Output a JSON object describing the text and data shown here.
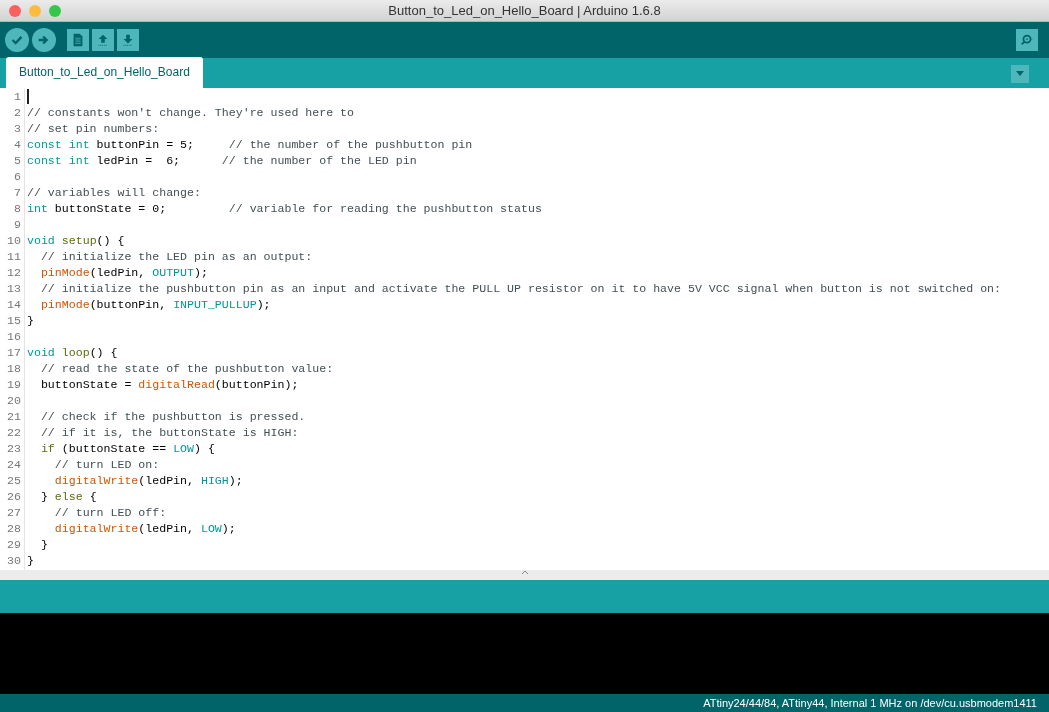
{
  "window": {
    "title": "Button_to_Led_on_Hello_Board | Arduino 1.6.8"
  },
  "toolbar": {
    "buttons": [
      {
        "kind": "verify"
      },
      {
        "kind": "upload"
      },
      {
        "kind": "new"
      },
      {
        "kind": "open"
      },
      {
        "kind": "save"
      }
    ],
    "right_button": {
      "kind": "serial"
    }
  },
  "tabs": [
    {
      "label": "Button_to_Led_on_Hello_Board",
      "selected": true
    }
  ],
  "editor": {
    "lines": [
      {
        "number": "1",
        "cursor": true
      },
      {
        "number": "2",
        "tokens": [
          {
            "kind": "comment",
            "text": "// constants won't change. They're used here to"
          }
        ]
      },
      {
        "number": "3",
        "tokens": [
          {
            "kind": "comment",
            "text": "// set pin numbers:"
          }
        ]
      },
      {
        "number": "4",
        "tokens": [
          {
            "kind": "keyword",
            "text": "const int"
          },
          {
            "kind": "plain",
            "text": " buttonPin = 5;     "
          },
          {
            "kind": "comment",
            "text": "// the number of the pushbutton pin"
          }
        ]
      },
      {
        "number": "5",
        "tokens": [
          {
            "kind": "keyword",
            "text": "const int"
          },
          {
            "kind": "plain",
            "text": " ledPin =  6;      "
          },
          {
            "kind": "comment",
            "text": "// the number of the LED pin"
          }
        ]
      },
      {
        "number": "6"
      },
      {
        "number": "7",
        "tokens": [
          {
            "kind": "comment",
            "text": "// variables will change:"
          }
        ]
      },
      {
        "number": "8",
        "tokens": [
          {
            "kind": "keyword",
            "text": "int"
          },
          {
            "kind": "plain",
            "text": " buttonState = 0;         "
          },
          {
            "kind": "comment",
            "text": "// variable for reading the pushbutton status"
          }
        ]
      },
      {
        "number": "9"
      },
      {
        "number": "10",
        "tokens": [
          {
            "kind": "keyword",
            "text": "void "
          },
          {
            "kind": "structure",
            "text": "setup"
          },
          {
            "kind": "plain",
            "text": "() {"
          }
        ]
      },
      {
        "number": "11",
        "tokens": [
          {
            "kind": "comment",
            "text": "  // initialize the LED pin as an output:"
          }
        ]
      },
      {
        "number": "12",
        "tokens": [
          {
            "kind": "function",
            "text": "  pinMode"
          },
          {
            "kind": "plain",
            "text": "(ledPin, "
          },
          {
            "kind": "constant",
            "text": "OUTPUT"
          },
          {
            "kind": "plain",
            "text": ");"
          }
        ]
      },
      {
        "number": "13",
        "tokens": [
          {
            "kind": "comment",
            "text": "  // initialize the pushbutton pin as an input and activate the PULL UP resistor on it to have 5V VCC signal when button is not switched on:"
          }
        ]
      },
      {
        "number": "14",
        "tokens": [
          {
            "kind": "function",
            "text": "  pinMode"
          },
          {
            "kind": "plain",
            "text": "(buttonPin, "
          },
          {
            "kind": "constant",
            "text": "INPUT_PULLUP"
          },
          {
            "kind": "plain",
            "text": ");"
          }
        ]
      },
      {
        "number": "15",
        "tokens": [
          {
            "kind": "plain",
            "text": "}"
          }
        ]
      },
      {
        "number": "16"
      },
      {
        "number": "17",
        "tokens": [
          {
            "kind": "keyword",
            "text": "void "
          },
          {
            "kind": "structure",
            "text": "loop"
          },
          {
            "kind": "plain",
            "text": "() {"
          }
        ]
      },
      {
        "number": "18",
        "tokens": [
          {
            "kind": "comment",
            "text": "  // read the state of the pushbutton value:"
          }
        ]
      },
      {
        "number": "19",
        "tokens": [
          {
            "kind": "plain",
            "text": "  buttonState = "
          },
          {
            "kind": "function",
            "text": "digitalRead"
          },
          {
            "kind": "plain",
            "text": "(buttonPin);"
          }
        ]
      },
      {
        "number": "20"
      },
      {
        "number": "21",
        "tokens": [
          {
            "kind": "comment",
            "text": "  // check if the pushbutton is pressed."
          }
        ]
      },
      {
        "number": "22",
        "tokens": [
          {
            "kind": "comment",
            "text": "  // if it is, the buttonState is HIGH:"
          }
        ]
      },
      {
        "number": "23",
        "tokens": [
          {
            "kind": "structure",
            "text": "  if"
          },
          {
            "kind": "plain",
            "text": " (buttonState == "
          },
          {
            "kind": "constant",
            "text": "LOW"
          },
          {
            "kind": "plain",
            "text": ") {"
          }
        ]
      },
      {
        "number": "24",
        "tokens": [
          {
            "kind": "comment",
            "text": "    // turn LED on:"
          }
        ]
      },
      {
        "number": "25",
        "tokens": [
          {
            "kind": "function",
            "text": "    digitalWrite"
          },
          {
            "kind": "plain",
            "text": "(ledPin, "
          },
          {
            "kind": "constant",
            "text": "HIGH"
          },
          {
            "kind": "plain",
            "text": ");"
          }
        ]
      },
      {
        "number": "26",
        "tokens": [
          {
            "kind": "plain",
            "text": "  } "
          },
          {
            "kind": "structure",
            "text": "else"
          },
          {
            "kind": "plain",
            "text": " {"
          }
        ]
      },
      {
        "number": "27",
        "tokens": [
          {
            "kind": "comment",
            "text": "    // turn LED off:"
          }
        ]
      },
      {
        "number": "28",
        "tokens": [
          {
            "kind": "function",
            "text": "    digitalWrite"
          },
          {
            "kind": "plain",
            "text": "(ledPin, "
          },
          {
            "kind": "constant",
            "text": "LOW"
          },
          {
            "kind": "plain",
            "text": ");"
          }
        ]
      },
      {
        "number": "29",
        "tokens": [
          {
            "kind": "plain",
            "text": "  }"
          }
        ]
      },
      {
        "number": "30",
        "tokens": [
          {
            "kind": "plain",
            "text": "}"
          }
        ]
      }
    ]
  },
  "status_bar": {
    "text": "ATtiny24/44/84, ATtiny44, Internal 1 MHz on /dev/cu.usbmodem1411"
  }
}
